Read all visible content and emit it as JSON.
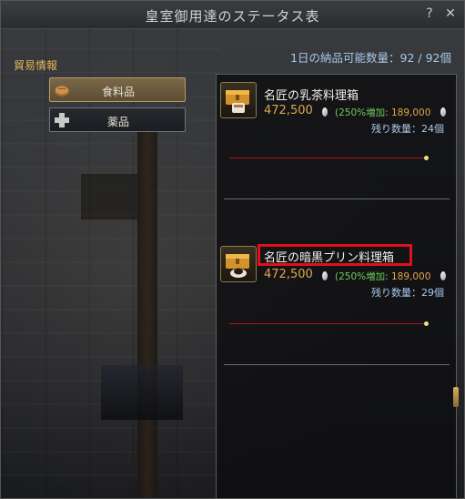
{
  "window": {
    "title": "皇室御用達のステータス表",
    "help": "?",
    "close": "✕"
  },
  "trade_info_label": "貿易情報",
  "daily_limit": "1日の納品可能数量：92 / 92個",
  "categories": [
    {
      "label": "食料品",
      "icon": "bread-icon",
      "selected": true
    },
    {
      "label": "薬品",
      "icon": "plus-icon",
      "selected": false
    }
  ],
  "items": [
    {
      "name": "名匠の乳茶料理箱",
      "price": "472,500",
      "bonus_pct": "(250%",
      "bonus_rest": "増加",
      "orig_price": ": 189,000",
      "remaining": "残り数量：24個",
      "icon": "cooking-box-tea-icon"
    },
    {
      "name": "名匠の暗黒プリン料理箱",
      "price": "472,500",
      "bonus_pct": "(250%",
      "bonus_rest": "増加",
      "orig_price": ": 189,000",
      "remaining": "残り数量：29個",
      "icon": "cooking-box-pudding-icon"
    }
  ],
  "colors": {
    "accent": "#dfa64c",
    "bonus": "#6ecb58",
    "highlight": "#e0101c",
    "info": "#a9c8e8"
  }
}
